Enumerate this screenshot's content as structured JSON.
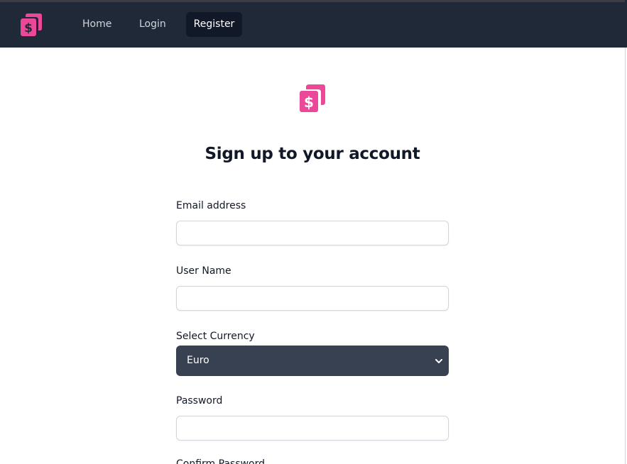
{
  "nav": {
    "logo_icon": "dollar-copy-icon",
    "items": [
      {
        "label": "Home",
        "active": false
      },
      {
        "label": "Login",
        "active": false
      },
      {
        "label": "Register",
        "active": true
      }
    ]
  },
  "brand": {
    "logo_icon": "dollar-copy-icon",
    "accent_color": "#ec4899"
  },
  "page": {
    "title": "Sign up to your account"
  },
  "form": {
    "email": {
      "label": "Email address",
      "value": ""
    },
    "username": {
      "label": "User Name",
      "value": ""
    },
    "currency": {
      "label": "Select Currency",
      "selected": "Euro"
    },
    "password": {
      "label": "Password",
      "value": ""
    },
    "confirm_password": {
      "label": "Confirm Password"
    }
  },
  "colors": {
    "navbar_bg": "#1f2937",
    "active_nav_bg": "#111827",
    "select_bg": "#374151"
  }
}
